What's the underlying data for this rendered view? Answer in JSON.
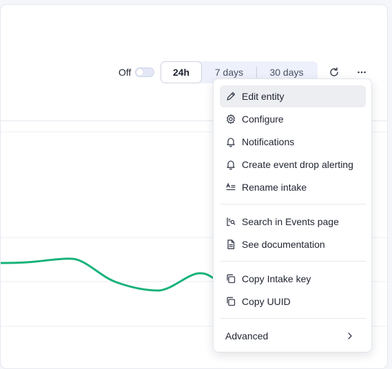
{
  "toolbar": {
    "toggle_label": "Off",
    "toggle_on": false,
    "time_ranges": [
      "24h",
      "7 days",
      "30 days"
    ],
    "active_range": "24h",
    "refresh_icon": "refresh-icon",
    "more_icon": "more-horizontal-icon"
  },
  "menu": {
    "items": [
      {
        "label": "Edit entity",
        "icon": "pencil-icon",
        "highlighted": true
      },
      {
        "label": "Configure",
        "icon": "gear-icon"
      },
      {
        "label": "Notifications",
        "icon": "bell-icon"
      },
      {
        "label": "Create event drop alerting",
        "icon": "bell-icon"
      },
      {
        "label": "Rename intake",
        "icon": "rename-icon"
      },
      {
        "label": "Search in Events page",
        "icon": "search-list-icon"
      },
      {
        "label": "See documentation",
        "icon": "document-icon"
      },
      {
        "label": "Copy Intake key",
        "icon": "copy-icon"
      },
      {
        "label": "Copy UUID",
        "icon": "copy-icon"
      },
      {
        "label": "Advanced",
        "icon": "chevron-right-icon"
      }
    ]
  },
  "colors": {
    "line": "#17b27a",
    "accent_bg": "#eef1fb"
  }
}
